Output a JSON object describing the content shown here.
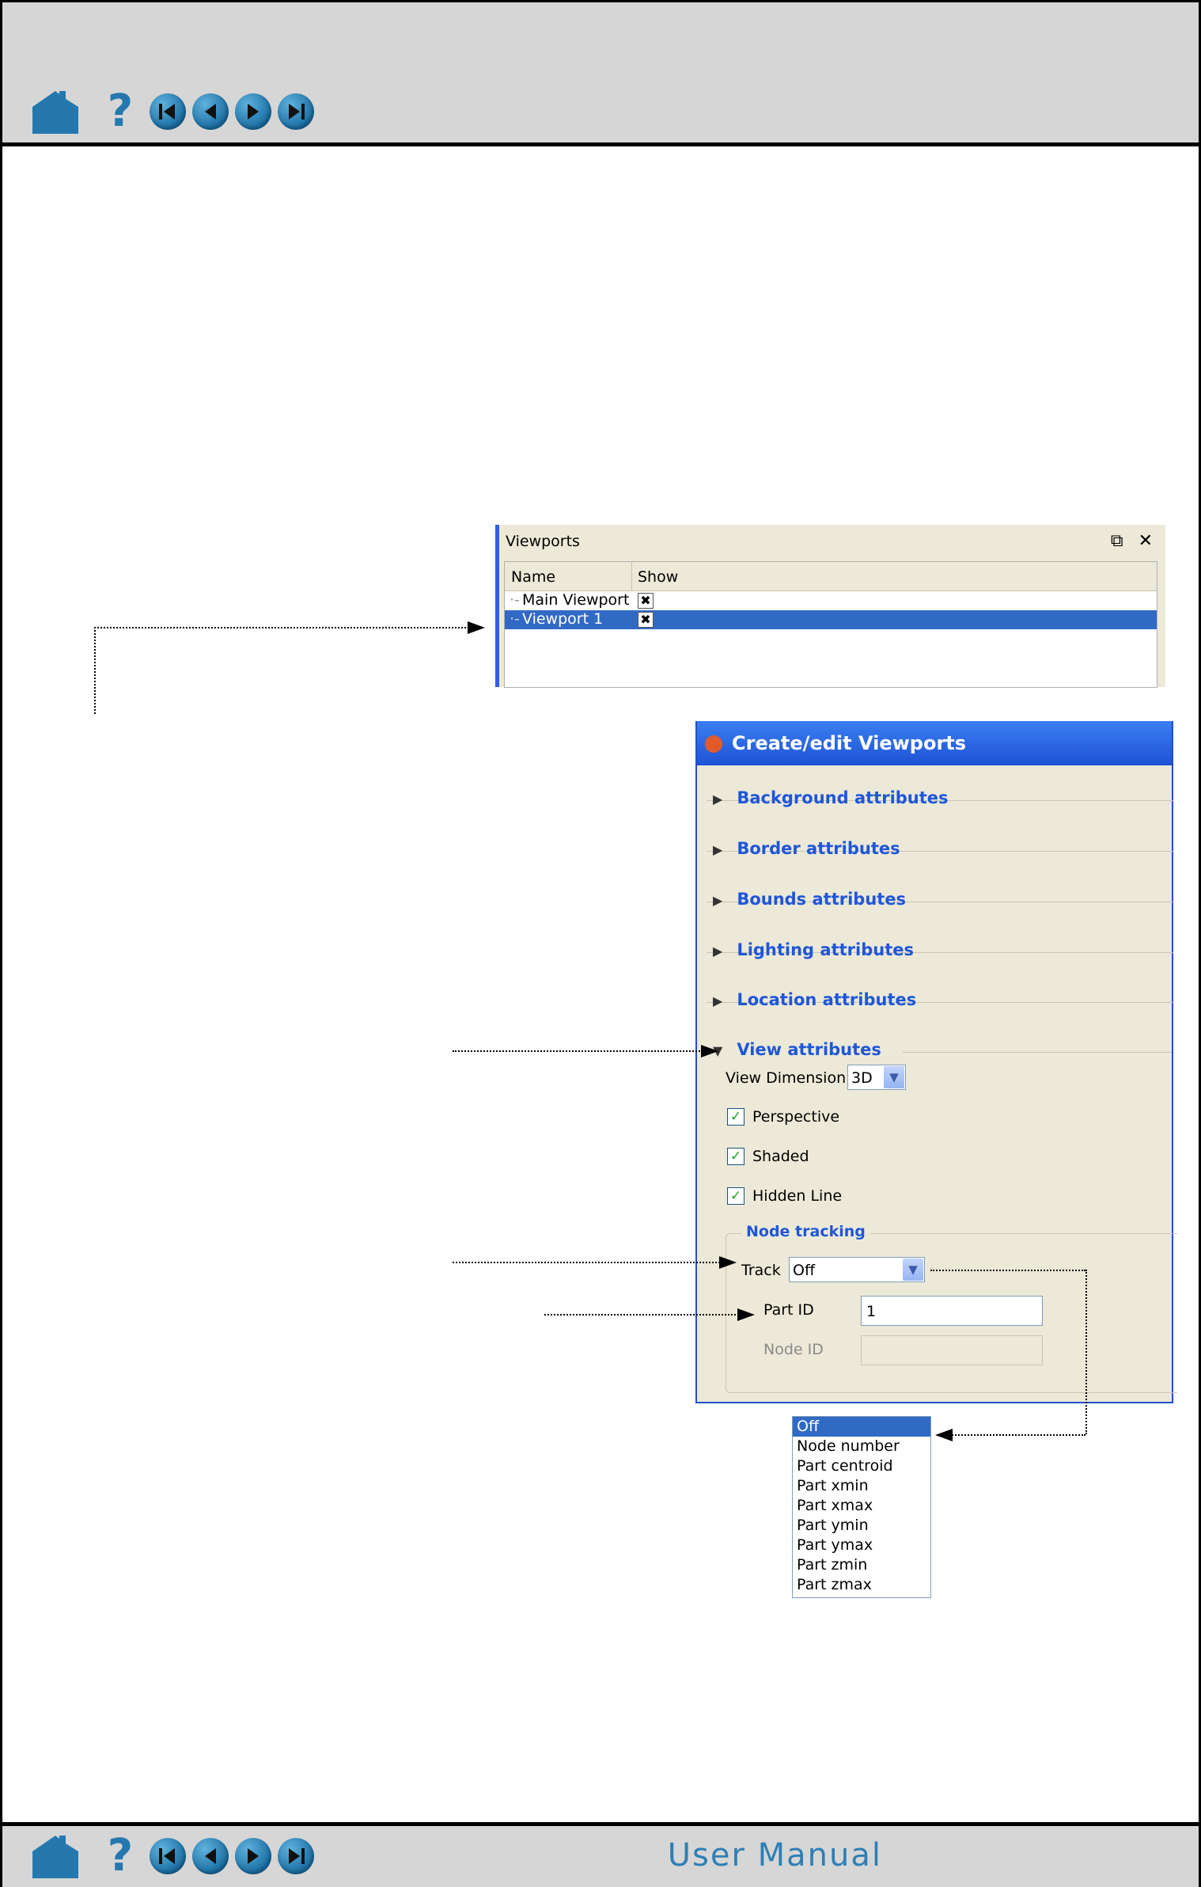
{
  "footer": {
    "title": "User Manual"
  },
  "viewports_panel": {
    "title": "Viewports",
    "columns": [
      "Name",
      "Show"
    ],
    "rows": [
      {
        "name": "Main Viewport",
        "selected": false
      },
      {
        "name": "Viewport 1",
        "selected": true
      }
    ]
  },
  "dialog": {
    "title": "Create/edit Viewports",
    "sections": [
      "Background attributes",
      "Border attributes",
      "Bounds attributes",
      "Lighting attributes",
      "Location attributes",
      "View attributes"
    ],
    "view_dimension_label": "View Dimension",
    "view_dimension_value": "3D",
    "perspective_label": "Perspective",
    "shaded_label": "Shaded",
    "hidden_line_label": "Hidden Line",
    "node_tracking_label": "Node tracking",
    "track_label": "Track",
    "track_value": "Off",
    "part_id_label": "Part ID",
    "part_id_value": "1",
    "node_id_label": "Node ID"
  },
  "track_options": [
    "Off",
    "Node number",
    "Part centroid",
    "Part xmin",
    "Part xmax",
    "Part ymin",
    "Part ymax",
    "Part zmin",
    "Part zmax"
  ],
  "icons": [
    "home-icon",
    "help-icon",
    "first-page-icon",
    "prev-page-icon",
    "next-page-icon",
    "last-page-icon",
    "restore-icon",
    "close-icon",
    "checkmark-icon",
    "dropdown-arrow-icon",
    "expand-triangle-icon",
    "collapse-triangle-icon"
  ]
}
